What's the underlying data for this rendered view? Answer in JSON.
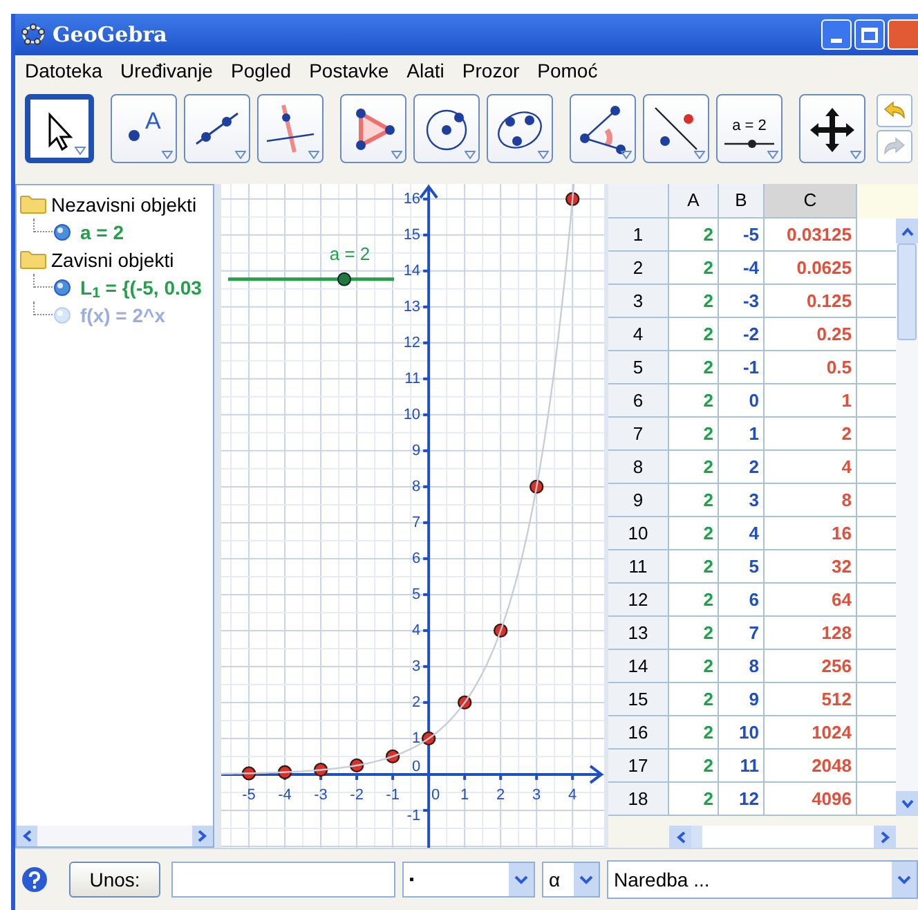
{
  "window": {
    "title": "GeoGebra"
  },
  "menu": [
    "Datoteka",
    "Uređivanje",
    "Pogled",
    "Postavke",
    "Alati",
    "Prozor",
    "Pomoć"
  ],
  "toolbar": {
    "groups": [
      [
        {
          "kind": "move",
          "selected": true
        }
      ],
      [
        {
          "kind": "point",
          "label": "A",
          "selected": false
        },
        {
          "kind": "line",
          "selected": false
        },
        {
          "kind": "perpendicular",
          "selected": false
        }
      ],
      [
        {
          "kind": "polygon",
          "selected": false
        },
        {
          "kind": "circle",
          "selected": false
        },
        {
          "kind": "conic",
          "selected": false
        }
      ],
      [
        {
          "kind": "angle",
          "selected": false
        },
        {
          "kind": "reflect",
          "selected": false
        },
        {
          "kind": "slider",
          "label": "a = 2",
          "selected": false
        }
      ],
      [
        {
          "kind": "translate",
          "selected": false
        }
      ]
    ],
    "history": [
      {
        "kind": "undo",
        "disabled": false
      },
      {
        "kind": "redo",
        "disabled": true
      }
    ]
  },
  "algebra": {
    "folders": [
      {
        "label": "Nezavisni objekti",
        "children": [
          {
            "label": "a = 2",
            "visible": true,
            "color": "#23a04a"
          }
        ]
      },
      {
        "label": "Zavisni objekti",
        "children": [
          {
            "label": "L$_{1}$ = {(-5, 0.03",
            "visible": true,
            "color": "#23a04a"
          },
          {
            "label": "f(x) = 2^x",
            "visible": false,
            "color": "#9aaee2"
          }
        ]
      }
    ]
  },
  "graphics": {
    "slider": {
      "label": "a = 2",
      "level": 0.7
    },
    "chart_data": {
      "type": "scatter",
      "x": [
        -5,
        -4,
        -3,
        -2,
        -1,
        0,
        1,
        2,
        3,
        4
      ],
      "grid": true,
      "series": [
        {
          "color": "#d9302a",
          "values": [
            0.03,
            0.06,
            0.13,
            0.25,
            0.5,
            1,
            2,
            4,
            8,
            16
          ]
        }
      ],
      "xlim": [
        -5.77,
        4.88
      ],
      "ylim": [
        -2.04,
        16.42
      ],
      "xticks": [
        -5,
        -4,
        -3,
        -2,
        -1,
        0,
        1,
        2,
        3,
        4
      ],
      "yticks": [
        -1,
        0,
        1,
        2,
        3,
        4,
        5,
        6,
        7,
        8,
        9,
        10,
        11,
        12,
        13,
        14,
        15,
        16
      ]
    }
  },
  "spreadsheet": {
    "columns": [
      {
        "label": "A",
        "selected": false,
        "color": "#23a04a"
      },
      {
        "label": "B",
        "selected": false,
        "color": "#1f4fc0"
      },
      {
        "label": "C",
        "selected": true,
        "color": "#e0503a"
      }
    ],
    "rows": [
      {
        "label": "1",
        "cells": [
          "2",
          "-5",
          "0.03125"
        ]
      },
      {
        "label": "2",
        "cells": [
          "2",
          "-4",
          "0.0625"
        ]
      },
      {
        "label": "3",
        "cells": [
          "2",
          "-3",
          "0.125"
        ]
      },
      {
        "label": "4",
        "cells": [
          "2",
          "-2",
          "0.25"
        ]
      },
      {
        "label": "5",
        "cells": [
          "2",
          "-1",
          "0.5"
        ]
      },
      {
        "label": "6",
        "cells": [
          "2",
          "0",
          "1"
        ]
      },
      {
        "label": "7",
        "cells": [
          "2",
          "1",
          "2"
        ]
      },
      {
        "label": "8",
        "cells": [
          "2",
          "2",
          "4"
        ]
      },
      {
        "label": "9",
        "cells": [
          "2",
          "3",
          "8"
        ]
      },
      {
        "label": "10",
        "cells": [
          "2",
          "4",
          "16"
        ]
      },
      {
        "label": "11",
        "cells": [
          "2",
          "5",
          "32"
        ]
      },
      {
        "label": "12",
        "cells": [
          "2",
          "6",
          "64"
        ]
      },
      {
        "label": "13",
        "cells": [
          "2",
          "7",
          "128"
        ]
      },
      {
        "label": "14",
        "cells": [
          "2",
          "8",
          "256"
        ]
      },
      {
        "label": "15",
        "cells": [
          "2",
          "9",
          "512"
        ]
      },
      {
        "label": "16",
        "cells": [
          "2",
          "10",
          "1024"
        ]
      },
      {
        "label": "17",
        "cells": [
          "2",
          "11",
          "2048"
        ]
      },
      {
        "label": "18",
        "cells": [
          "2",
          "12",
          "4096"
        ]
      }
    ]
  },
  "input_bar": {
    "label": "Unos:",
    "symbol": "▪",
    "greek": "α",
    "command": "Naredba ..."
  }
}
